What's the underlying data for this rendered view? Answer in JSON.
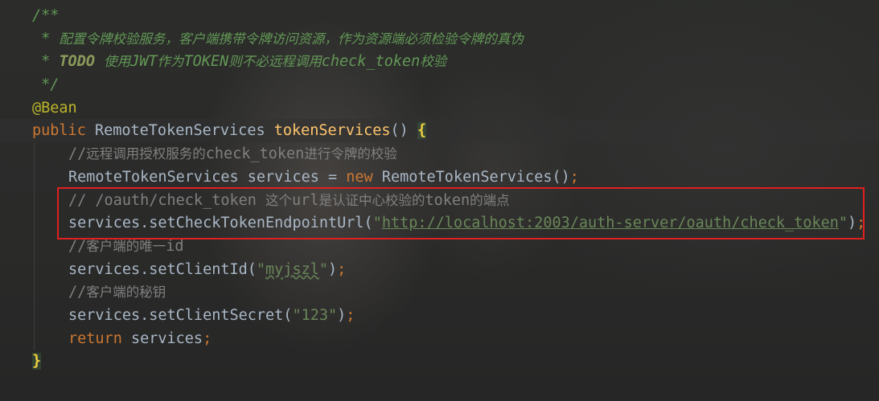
{
  "editor": {
    "language": "java",
    "lines": [
      {
        "id": "l1",
        "indent": 0,
        "tokens": [
          {
            "kind": "comment",
            "text": "/**"
          }
        ]
      },
      {
        "id": "l2",
        "indent": 0,
        "tokens": [
          {
            "kind": "comment",
            "text": " * 配置令牌校验服务，客户端携带令牌访问资源，作为资源端必须检验令牌的真伪"
          }
        ]
      },
      {
        "id": "l3",
        "indent": 0,
        "tokens": [
          {
            "kind": "comment",
            "text": " * "
          },
          {
            "kind": "comment-kw",
            "text": "TODO"
          },
          {
            "kind": "comment",
            "text": " 使用JWT作为TOKEN则不必远程调用check_token校验"
          }
        ]
      },
      {
        "id": "l4",
        "indent": 0,
        "tokens": [
          {
            "kind": "comment",
            "text": " */"
          }
        ]
      },
      {
        "id": "l5",
        "indent": 0,
        "tokens": [
          {
            "kind": "anno",
            "text": "@Bean"
          }
        ]
      },
      {
        "id": "l6",
        "indent": 0,
        "current": true,
        "tokens": [
          {
            "kind": "kw",
            "text": "public "
          },
          {
            "kind": "type",
            "text": "RemoteTokenServices "
          },
          {
            "kind": "method",
            "text": "tokenServices"
          },
          {
            "kind": "punct",
            "text": "() "
          },
          {
            "kind": "brace-hl",
            "text": "{"
          }
        ]
      },
      {
        "id": "l7",
        "indent": 1,
        "tokens": [
          {
            "kind": "gray",
            "text": "//远程调用授权服务的check_token进行令牌的校验"
          }
        ]
      },
      {
        "id": "l8",
        "indent": 1,
        "tokens": [
          {
            "kind": "type",
            "text": "RemoteTokenServices services = "
          },
          {
            "kind": "kw",
            "text": "new "
          },
          {
            "kind": "type",
            "text": "RemoteTokenServices()"
          },
          {
            "kind": "semi",
            "text": ";"
          }
        ]
      },
      {
        "id": "l9",
        "indent": 1,
        "tokens": [
          {
            "kind": "gray",
            "text": "// /oauth/check_token 这个url是认证中心校验的token的端点"
          }
        ]
      },
      {
        "id": "l10",
        "indent": 1,
        "tokens": [
          {
            "kind": "type",
            "text": "services.setCheckTokenEndpointUrl("
          },
          {
            "kind": "string",
            "text": "\""
          },
          {
            "kind": "link",
            "text": "http://localhost:2003/auth-server/oauth/check_token"
          },
          {
            "kind": "string",
            "text": "\""
          },
          {
            "kind": "punct",
            "text": ")"
          },
          {
            "kind": "semi",
            "text": ";"
          }
        ]
      },
      {
        "id": "l11",
        "indent": 1,
        "tokens": [
          {
            "kind": "gray",
            "text": "//客户端的唯一id"
          }
        ]
      },
      {
        "id": "l12",
        "indent": 1,
        "tokens": [
          {
            "kind": "type",
            "text": "services.setClientId("
          },
          {
            "kind": "string",
            "text": "\""
          },
          {
            "kind": "squiggle",
            "text": "myjszl"
          },
          {
            "kind": "string",
            "text": "\""
          },
          {
            "kind": "punct",
            "text": ")"
          },
          {
            "kind": "semi",
            "text": ";"
          }
        ]
      },
      {
        "id": "l13",
        "indent": 1,
        "tokens": [
          {
            "kind": "gray",
            "text": "//客户端的秘钥"
          }
        ]
      },
      {
        "id": "l14",
        "indent": 1,
        "tokens": [
          {
            "kind": "type",
            "text": "services.setClientSecret("
          },
          {
            "kind": "string",
            "text": "\"123\""
          },
          {
            "kind": "punct",
            "text": ")"
          },
          {
            "kind": "semi",
            "text": ";"
          }
        ]
      },
      {
        "id": "l15",
        "indent": 1,
        "tokens": [
          {
            "kind": "kw",
            "text": "return "
          },
          {
            "kind": "type",
            "text": "services"
          },
          {
            "kind": "semi",
            "text": ";"
          }
        ]
      },
      {
        "id": "l16",
        "indent": 0,
        "tokens": [
          {
            "kind": "brace-hl",
            "text": "}"
          }
        ]
      }
    ]
  },
  "annotation": {
    "highlight_lines": [
      "l9",
      "l10"
    ],
    "color": "#e02020"
  },
  "colors": {
    "background": "#2b2b2b",
    "comment": "#629755",
    "keyword": "#cc7832",
    "annotation": "#bbb529",
    "method": "#ffc66d",
    "string": "#6a8759",
    "default": "#a9b7c6",
    "line_comment": "#808080"
  }
}
